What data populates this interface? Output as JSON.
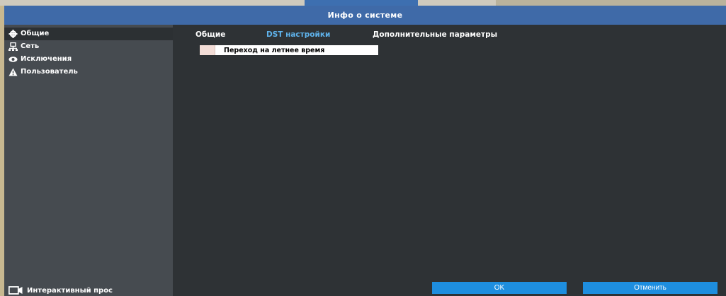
{
  "window": {
    "title": "Инфо о системе"
  },
  "sidebar": {
    "items": [
      {
        "label": "Общие",
        "icon": "gear-icon",
        "active": true
      },
      {
        "label": "Сеть",
        "icon": "network-icon",
        "active": false
      },
      {
        "label": "Исключения",
        "icon": "eye-icon",
        "active": false
      },
      {
        "label": "Пользователь",
        "icon": "warning-icon",
        "active": false
      }
    ],
    "bottom": {
      "label": "Интерактивный прос",
      "icon": "camera-icon"
    }
  },
  "tabs": [
    {
      "label": "Общие",
      "active": false
    },
    {
      "label": "DST настройки",
      "active": true
    },
    {
      "label": "Дополнительные параметры",
      "active": false
    }
  ],
  "dst": {
    "checkbox_label": "Переход на летнее время",
    "checked": false
  },
  "buttons": {
    "ok": "OK",
    "cancel": "Отменить"
  },
  "colors": {
    "accent": "#1e8edf",
    "active_tab": "#5fb3ec",
    "titlebar": "#3f6aa8",
    "sidebar": "#464b50",
    "panel": "#2e3235"
  }
}
